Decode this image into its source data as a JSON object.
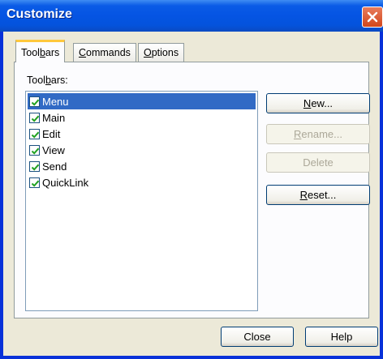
{
  "window": {
    "title": "Customize"
  },
  "tabs": [
    {
      "label_pre": "Tool",
      "mnemonic": "b",
      "label_post": "ars",
      "active": true
    },
    {
      "label_pre": "",
      "mnemonic": "C",
      "label_post": "ommands",
      "active": false
    },
    {
      "label_pre": "",
      "mnemonic": "O",
      "label_post": "ptions",
      "active": false
    }
  ],
  "toolbars_group": {
    "label_pre": "Tool",
    "mnemonic": "b",
    "label_post": "ars:",
    "items": [
      {
        "label": "Menu",
        "checked": true,
        "selected": true
      },
      {
        "label": "Main",
        "checked": true,
        "selected": false
      },
      {
        "label": "Edit",
        "checked": true,
        "selected": false
      },
      {
        "label": "View",
        "checked": true,
        "selected": false
      },
      {
        "label": "Send",
        "checked": true,
        "selected": false
      },
      {
        "label": "QuickLink",
        "checked": true,
        "selected": false
      }
    ]
  },
  "buttons": {
    "new": {
      "mnemonic": "N",
      "rest": "ew...",
      "enabled": true
    },
    "rename": {
      "mnemonic": "R",
      "rest": "ename...",
      "enabled": false
    },
    "delete": {
      "label": "Delete",
      "enabled": false
    },
    "reset": {
      "mnemonic": "R",
      "rest": "eset...",
      "enabled": true
    },
    "close": {
      "label": "Close"
    },
    "help": {
      "label": "Help"
    }
  },
  "colors": {
    "titlebar": "#0554e3",
    "selection": "#316ac5",
    "active_tab_accent": "#ffc83c",
    "checkmark": "#21a121"
  }
}
